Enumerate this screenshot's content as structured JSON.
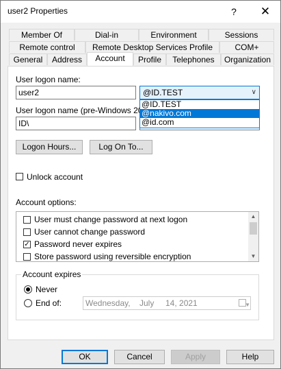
{
  "window": {
    "title": "user2 Properties",
    "help_glyph": "?",
    "close_glyph": "✕"
  },
  "tabs_row1": [
    "Member Of",
    "Dial-in",
    "Environment",
    "Sessions"
  ],
  "tabs_row2": [
    "Remote control",
    "Remote Desktop Services Profile",
    "COM+"
  ],
  "tabs_row3": [
    "General",
    "Address",
    "Account",
    "Profile",
    "Telephones",
    "Organization"
  ],
  "active_tab": "Account",
  "account": {
    "logon_label": "User logon name:",
    "logon_value": "user2",
    "domain_selected": "@ID.TEST",
    "domain_options": [
      "@ID.TEST",
      "@nakivo.com",
      "@id.com"
    ],
    "domain_highlighted": "@nakivo.com",
    "pre2000_label": "User logon name (pre-Windows 2000):",
    "pre2000_domain": "ID\\",
    "logon_hours_button": "Logon Hours...",
    "log_on_to_button": "Log On To...",
    "unlock_label": "Unlock account",
    "options_label": "Account options:",
    "options": [
      {
        "label": "User must change password at next logon",
        "checked": false
      },
      {
        "label": "User cannot change password",
        "checked": false
      },
      {
        "label": "Password never expires",
        "checked": true
      },
      {
        "label": "Store password using reversible encryption",
        "checked": false
      }
    ],
    "expires_label": "Account expires",
    "never_label": "Never",
    "end_of_label": "End of:",
    "expires_selected": "Never",
    "date_weekday": "Wednesday,",
    "date_month": "July",
    "date_day_year": "14, 2021"
  },
  "footer": {
    "ok": "OK",
    "cancel": "Cancel",
    "apply": "Apply",
    "help": "Help"
  }
}
